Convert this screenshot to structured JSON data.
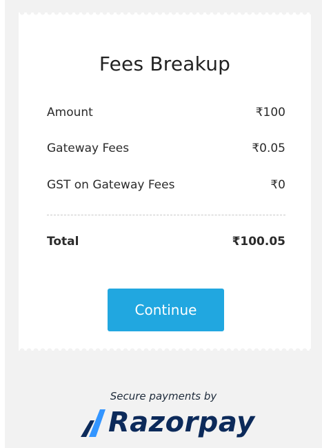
{
  "modal": {
    "title": "Fees Breakup",
    "rows": [
      {
        "label": "Amount",
        "value": "₹100"
      },
      {
        "label": "Gateway Fees",
        "value": "₹0.05"
      },
      {
        "label": "GST on Gateway Fees",
        "value": "₹0"
      }
    ],
    "total": {
      "label": "Total",
      "value": "₹100.05"
    },
    "continue_label": "Continue"
  },
  "footer": {
    "secure_text": "Secure payments by",
    "brand_name": "Razorpay",
    "brand_icon": "razorpay-logo-icon"
  },
  "colors": {
    "primary_button": "#21a7e0",
    "brand_dark": "#0c2a5a",
    "brand_light": "#3395ff",
    "background": "#f2f2f2"
  }
}
